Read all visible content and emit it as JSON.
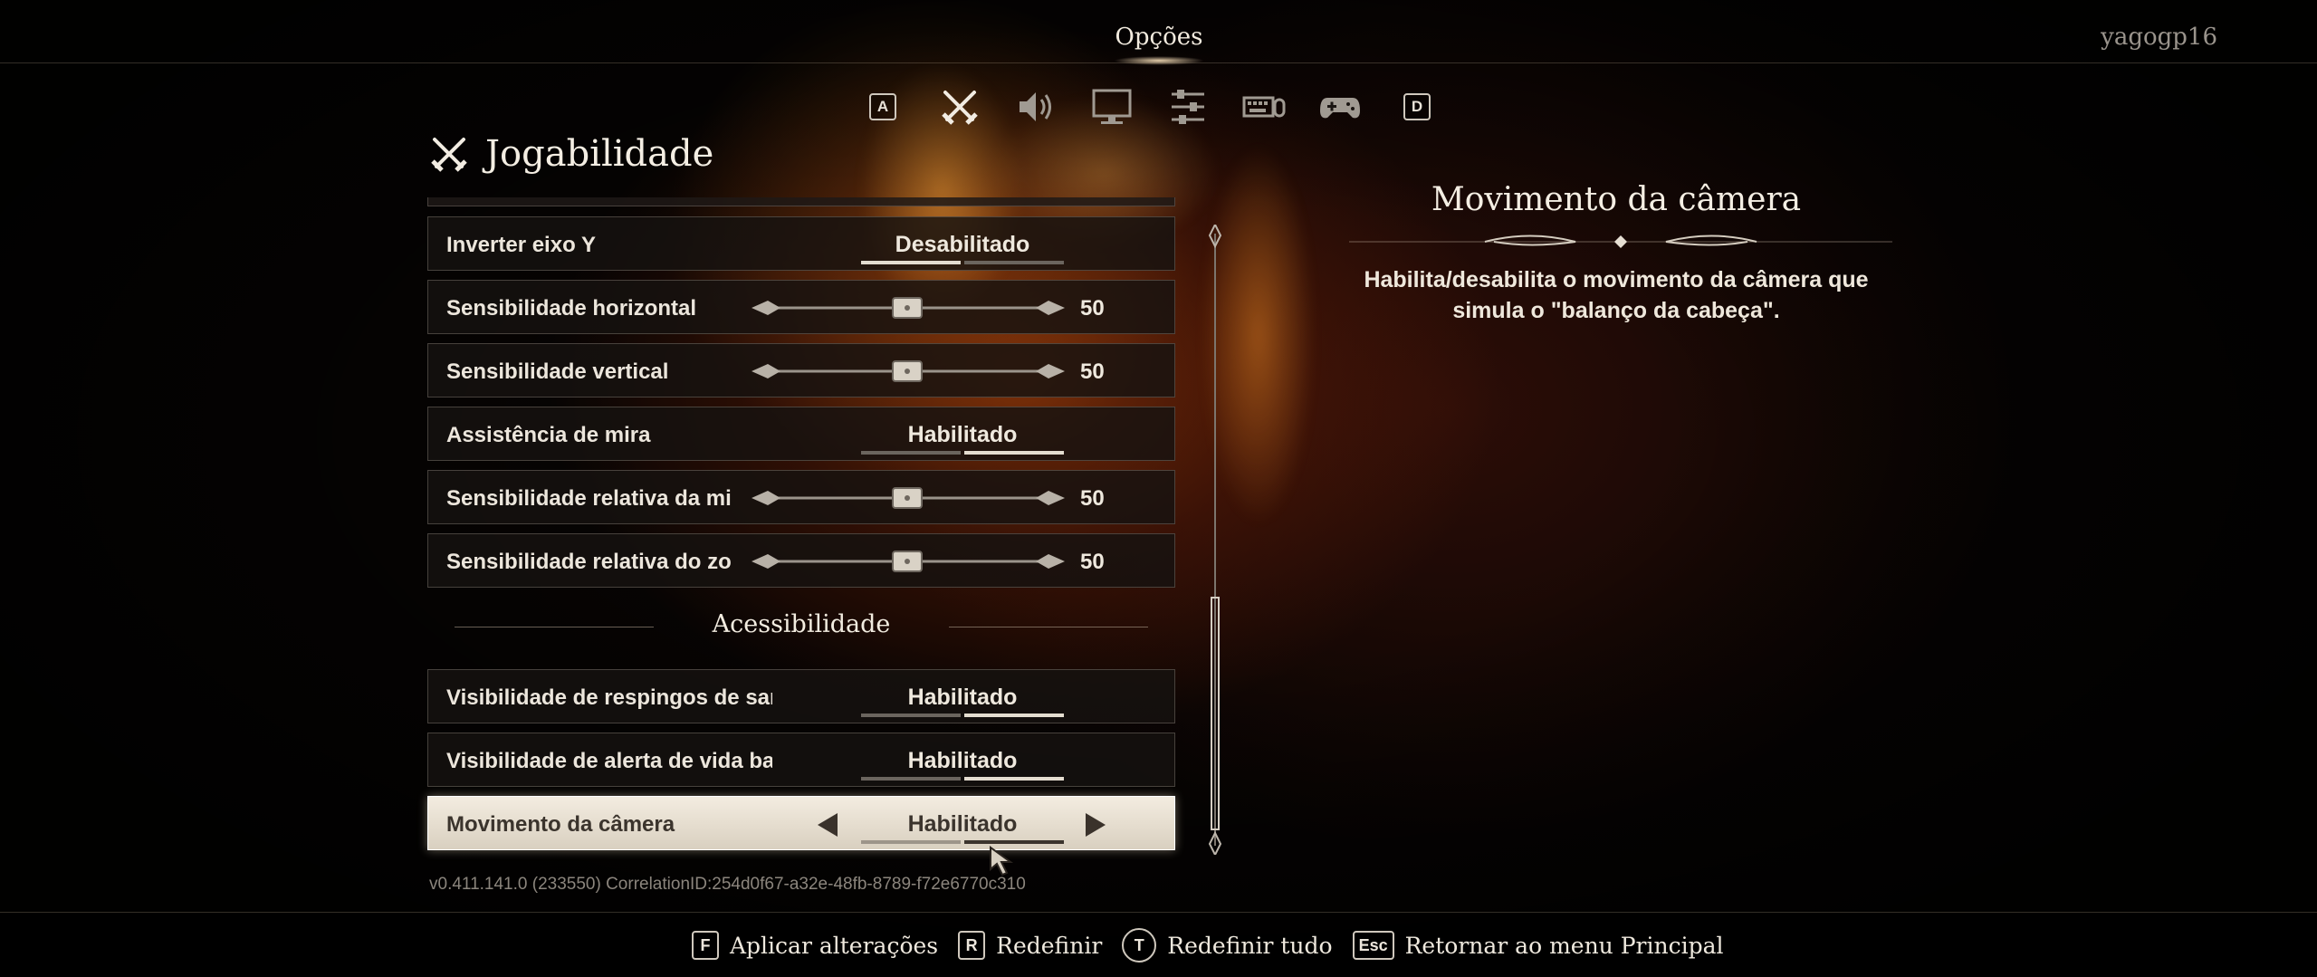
{
  "header": {
    "title": "Opções",
    "username": "yagogp16"
  },
  "tabs": {
    "left_key": "A",
    "right_key": "D",
    "icons": [
      "crossed-swords-icon",
      "speaker-icon",
      "monitor-icon",
      "sliders-icon",
      "keyboard-mouse-icon",
      "gamepad-icon"
    ],
    "active_icon": "crossed-swords-icon"
  },
  "page": {
    "title": "Jogabilidade"
  },
  "settings": [
    {
      "label": "Inverter eixo Y",
      "type": "toggle",
      "value": "Desabilitado",
      "state": "off"
    },
    {
      "label": "Sensibilidade horizontal",
      "type": "slider",
      "value": "50",
      "level": 0.5
    },
    {
      "label": "Sensibilidade vertical",
      "type": "slider",
      "value": "50",
      "level": 0.5
    },
    {
      "label": "Assistência de mira",
      "type": "toggle",
      "value": "Habilitado",
      "state": "on"
    },
    {
      "label": "Sensibilidade relativa da mi",
      "type": "slider",
      "value": "50",
      "level": 0.5
    },
    {
      "label": "Sensibilidade relativa do zo",
      "type": "slider",
      "value": "50",
      "level": 0.5
    }
  ],
  "section": {
    "title": "Acessibilidade"
  },
  "accessibility": [
    {
      "label": "Visibilidade de respingos de sang",
      "type": "toggle",
      "value": "Habilitado",
      "state": "on"
    },
    {
      "label": "Visibilidade de alerta de vida baix",
      "type": "toggle",
      "value": "Habilitado",
      "state": "on"
    },
    {
      "label": "Movimento da câmera",
      "type": "toggle",
      "value": "Habilitado",
      "state": "on",
      "selected": true
    }
  ],
  "info": {
    "title": "Movimento da câmera",
    "description": "Habilita/desabilita o movimento da câmera que simula o \"balanço da cabeça\"."
  },
  "version": "v0.411.141.0 (233550) CorrelationID:254d0f67-a32e-48fb-8789-f72e6770c310",
  "footer": {
    "hints": [
      {
        "key": "F",
        "label": "Aplicar alterações"
      },
      {
        "key": "R",
        "label": "Redefinir"
      },
      {
        "key": "T",
        "label": "Redefinir tudo"
      },
      {
        "key": "Esc",
        "label": "Retornar ao menu Principal"
      }
    ]
  },
  "colors": {
    "accent": "#e4ddd0",
    "selected_bg": "#f3ece0",
    "fire": "#ff8c1e"
  }
}
